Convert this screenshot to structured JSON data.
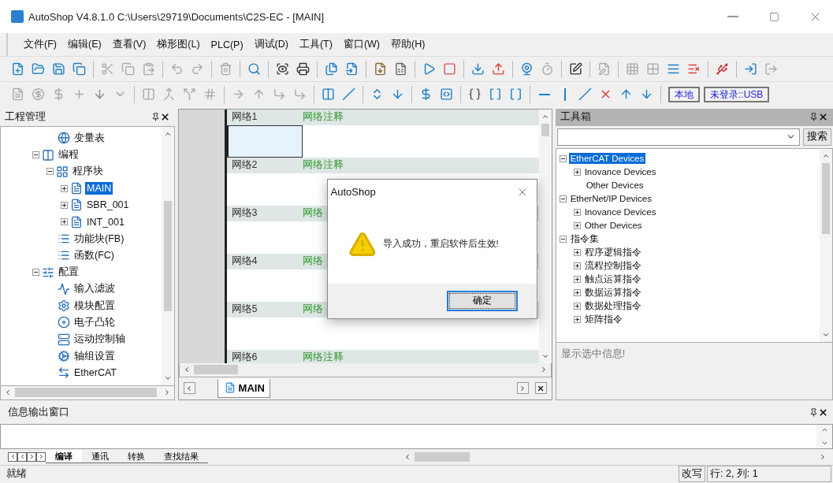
{
  "window": {
    "title": "AutoShop V4.8.1.0  C:\\Users\\29719\\Documents\\C2S-EC - [MAIN]"
  },
  "menu": [
    "文件(F)",
    "编辑(E)",
    "查看(V)",
    "梯形图(L)",
    "PLC(P)",
    "调试(D)",
    "工具(T)",
    "窗口(W)",
    "帮助(H)"
  ],
  "connection_buttons": [
    "本地",
    "未登录::USB"
  ],
  "project_panel": {
    "title": "工程管理",
    "tree": [
      {
        "children": [
          {
            "label": "变量表",
            "selected": false
          }
        ]
      },
      {
        "label": "编程",
        "selected": false,
        "expanded": true,
        "children": [
          {
            "label": "程序块",
            "selected": false,
            "expanded": true,
            "children": [
              {
                "label": "MAIN",
                "selected": true,
                "expanded": false
              },
              {
                "label": "SBR_001",
                "selected": false,
                "expanded": false
              },
              {
                "label": "INT_001",
                "selected": false,
                "expanded": false
              }
            ]
          },
          {
            "label": "功能块(FB)",
            "selected": false
          },
          {
            "label": "函数(FC)",
            "selected": false
          }
        ]
      },
      {
        "label": "配置",
        "selected": false,
        "expanded": true,
        "children": [
          {
            "label": "输入滤波",
            "selected": false
          },
          {
            "label": "模块配置",
            "selected": false
          },
          {
            "label": "电子凸轮",
            "selected": false
          },
          {
            "label": "运动控制轴",
            "selected": false
          },
          {
            "label": "轴组设置",
            "selected": false
          },
          {
            "label": "EtherCAT",
            "selected": false
          }
        ]
      }
    ]
  },
  "editor": {
    "networks": [
      {
        "label": "网络1",
        "comment": "网络注释",
        "cursor": true
      },
      {
        "label": "网络2",
        "comment": "网络注释",
        "cursor": false
      },
      {
        "label": "网络3",
        "comment": "网络",
        "cursor": false
      },
      {
        "label": "网络4",
        "comment": "网络",
        "cursor": false
      },
      {
        "label": "网络5",
        "comment": "网络",
        "cursor": false
      },
      {
        "label": "网络6",
        "comment": "网络注释",
        "cursor": false
      }
    ],
    "tabs": [
      {
        "label": "MAIN",
        "selected": true
      }
    ]
  },
  "dialog": {
    "title": "AutoShop",
    "message": "导入成功，重启软件后生效!",
    "button": "确定"
  },
  "toolbox": {
    "title": "工具箱",
    "search_button": "搜索",
    "tree": [
      {
        "label": "EtherCAT Devices",
        "selected": true,
        "expanded": true,
        "children": [
          {
            "label": "Inovance Devices",
            "selected": false,
            "expanded": false
          },
          {
            "label": "Other Devices",
            "selected": false
          }
        ]
      },
      {
        "label": "EtherNet/IP Devices",
        "selected": false,
        "expanded": true,
        "children": [
          {
            "label": "Inovance Devices",
            "selected": false,
            "expanded": false
          },
          {
            "label": "Other Devices",
            "selected": false,
            "expanded": false
          }
        ]
      },
      {
        "label": "指令集",
        "selected": false,
        "expanded": true,
        "children": [
          {
            "label": "程序逻辑指令",
            "selected": false,
            "expanded": false
          },
          {
            "label": "流程控制指令",
            "selected": false,
            "expanded": false
          },
          {
            "label": "触点运算指令",
            "selected": false,
            "expanded": false
          },
          {
            "label": "数据运算指令",
            "selected": false,
            "expanded": false
          },
          {
            "label": "数据处理指令",
            "selected": false,
            "expanded": false
          },
          {
            "label": "矩阵指令",
            "selected": false,
            "expanded": false
          }
        ]
      }
    ],
    "info": "显示选中信息!"
  },
  "output": {
    "title": "信息输出窗口",
    "tabs": [
      {
        "label": "编译",
        "selected": true
      },
      {
        "label": "通讯",
        "selected": false
      },
      {
        "label": "转换",
        "selected": false
      },
      {
        "label": "查找结果",
        "selected": false
      }
    ]
  },
  "status_bar": {
    "message": "就绪",
    "mode": "改写",
    "position": "行:  2, 列:  1"
  }
}
